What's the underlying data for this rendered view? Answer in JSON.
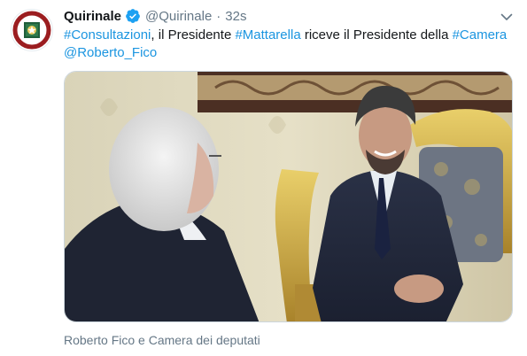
{
  "tweet": {
    "display_name": "Quirinale",
    "handle": "@Quirinale",
    "separator": "·",
    "time": "32s",
    "text_parts": {
      "p1": "#Consultazioni",
      "p2": ", il Presidente ",
      "p3": "#Mattarella",
      "p4": " riceve il Presidente della ",
      "p5": "#Camera",
      "p6": "@Roberto_Fico"
    },
    "media_caption": "Roberto Fico e Camera dei deputati"
  },
  "icons": {
    "avatar": "italian-presidency-emblem-icon",
    "verified": "verified-badge-icon",
    "menu": "chevron-down-icon"
  },
  "colors": {
    "link": "#1b95e0",
    "secondary_text": "#657786",
    "verified": "#1da1f2",
    "avatar_ring": "#9b1d20",
    "avatar_inner": "#1f5e3a"
  }
}
